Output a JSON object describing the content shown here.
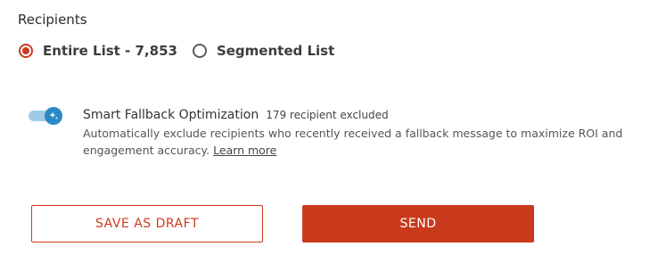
{
  "recipients": {
    "label": "Recipients",
    "options": [
      {
        "label": "Entire List - 7,853",
        "selected": true
      },
      {
        "label": "Segmented List",
        "selected": false
      }
    ]
  },
  "fallback": {
    "enabled": true,
    "title": "Smart Fallback Optimization",
    "excluded": "179 recipient excluded",
    "description": "Automatically exclude recipients who recently received a fallback message to maximize ROI and engagement accuracy.",
    "learn_more": "Learn more",
    "icon": "sparkle-icon"
  },
  "actions": {
    "draft_label": "SAVE AS DRAFT",
    "send_label": "SEND"
  },
  "colors": {
    "accent": "#cc3a1e",
    "toggle": "#2a8ac7",
    "toggle_track": "#9fcbe6"
  }
}
